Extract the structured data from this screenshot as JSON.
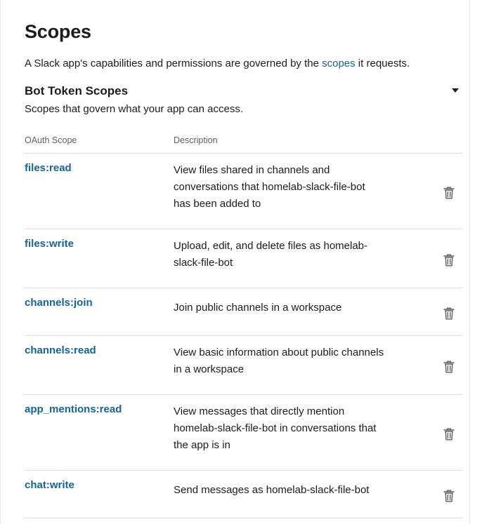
{
  "page": {
    "title": "Scopes",
    "intro_before": "A Slack app's capabilities and permissions are governed by the ",
    "intro_link": "scopes",
    "intro_after": " it requests."
  },
  "section": {
    "title": "Bot Token Scopes",
    "subtitle": "Scopes that govern what your app can access.",
    "toggle_icon": "caret-down-icon"
  },
  "table": {
    "headers": [
      "OAuth Scope",
      "Description"
    ],
    "rows": [
      {
        "scope": "files:read",
        "desc_lines": [
          "View files shared in channels and",
          "conversations that homelab-slack-file-bot",
          "has been added to"
        ],
        "action_icon": "trash-icon"
      },
      {
        "scope": "files:write",
        "desc_lines": [
          "Upload, edit, and delete files as homelab-",
          "slack-file-bot"
        ],
        "action_icon": "trash-icon"
      },
      {
        "scope": "channels:join",
        "desc_lines": [
          "Join public channels in a workspace"
        ],
        "action_icon": "trash-icon"
      },
      {
        "scope": "channels:read",
        "desc_lines": [
          "View basic information about public channels",
          "in a workspace"
        ],
        "action_icon": "trash-icon"
      },
      {
        "scope": "app_mentions:read",
        "desc_lines": [
          "View messages that directly mention",
          "homelab-slack-file-bot in conversations that",
          "the app is in"
        ],
        "action_icon": "trash-icon"
      },
      {
        "scope": "chat:write",
        "desc_lines": [
          "Send messages as homelab-slack-file-bot"
        ],
        "action_icon": "trash-icon"
      }
    ]
  },
  "colors": {
    "link": "#1264a3",
    "text": "#1d1c1d",
    "muted": "#616061",
    "divider": "#dddddd"
  }
}
